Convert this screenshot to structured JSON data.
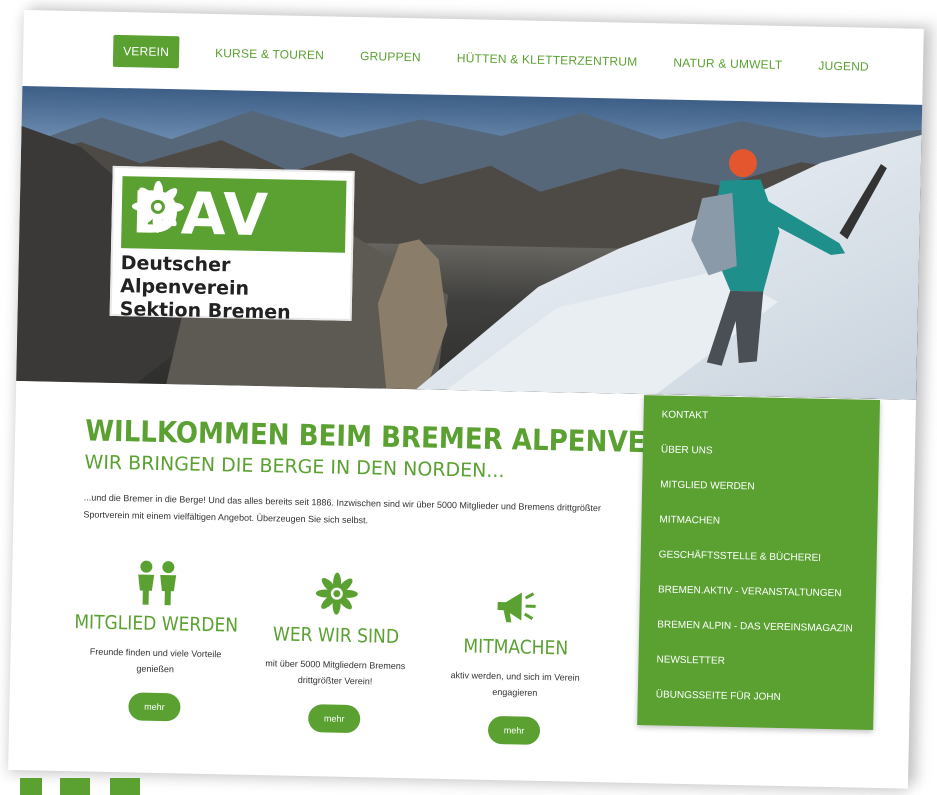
{
  "nav": {
    "items": [
      {
        "label": "VEREIN",
        "active": true
      },
      {
        "label": "KURSE & TOUREN",
        "active": false
      },
      {
        "label": "GRUPPEN",
        "active": false
      },
      {
        "label": "HÜTTEN & KLETTERZENTRUM",
        "active": false
      },
      {
        "label": "NATUR & UMWELT",
        "active": false
      },
      {
        "label": "JUGEND",
        "active": false
      }
    ]
  },
  "logo": {
    "mark": "DAV",
    "line1": "Deutscher Alpenverein",
    "line2": "Sektion Bremen"
  },
  "welcome": {
    "title": "WILLKOMMEN BEIM BREMER ALPENVEREIN",
    "subtitle": "WIR BRINGEN DIE BERGE IN DEN NORDEN...",
    "intro": "...und die Bremer in die Berge! Und das alles bereits seit 1886. Inzwischen sind wir über 5000 Mitglieder und Bremens drittgrößter Sportverein mit einem vielfältigen Angebot. Überzeugen Sie sich selbst."
  },
  "features": [
    {
      "icon": "people-icon",
      "title": "MITGLIED WERDEN",
      "text": "Freunde finden und viele Vorteile genießen",
      "button": "mehr"
    },
    {
      "icon": "edelweiss-icon",
      "title": "WER WIR SIND",
      "text": "mit über 5000 Mitgliedern Bremens drittgrößter Verein!",
      "button": "mehr"
    },
    {
      "icon": "megaphone-icon",
      "title": "MITMACHEN",
      "text": "aktiv werden, und sich im Verein engagieren",
      "button": "mehr"
    }
  ],
  "sidebar": {
    "items": [
      {
        "label": "KONTAKT"
      },
      {
        "label": "ÜBER UNS"
      },
      {
        "label": "MITGLIED WERDEN"
      },
      {
        "label": "MITMACHEN"
      },
      {
        "label": "GESCHÄFTSSTELLE & BÜCHEREI"
      },
      {
        "label": "BREMEN.AKTIV - VERANSTALTUNGEN"
      },
      {
        "label": "BREMEN ALPIN - DAS VEREINSMAGAZIN"
      },
      {
        "label": "NEWSLETTER"
      },
      {
        "label": "ÜBUNGSSEITE FÜR JOHN"
      }
    ]
  },
  "colors": {
    "brand_green": "#5aa132",
    "text_dark": "#333333",
    "white": "#ffffff"
  }
}
